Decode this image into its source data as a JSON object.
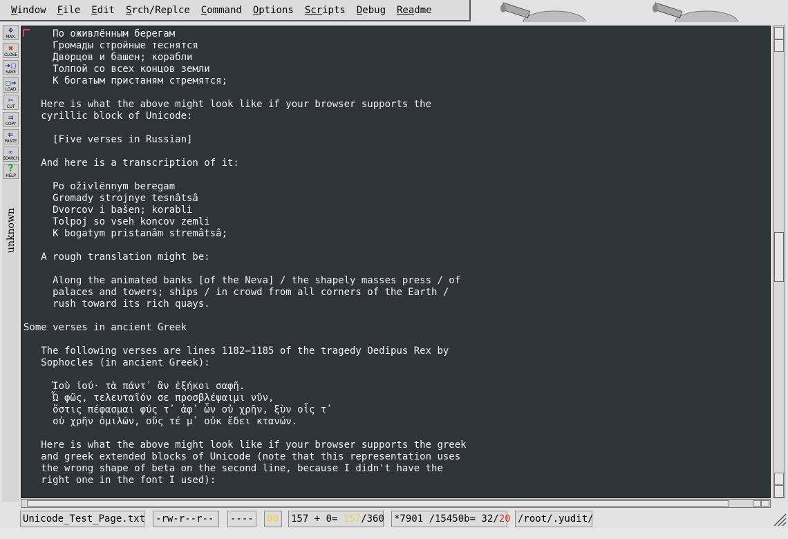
{
  "menubar": {
    "items": [
      {
        "name": "menu-window",
        "first": "W",
        "rest": "indow"
      },
      {
        "name": "menu-file",
        "first": "F",
        "rest": "ile"
      },
      {
        "name": "menu-edit",
        "first": "E",
        "rest": "dit"
      },
      {
        "name": "menu-search-replace",
        "first": "S",
        "rest": "rch/Replce"
      },
      {
        "name": "menu-command",
        "first": "C",
        "rest": "ommand"
      },
      {
        "name": "menu-options",
        "first": "O",
        "rest": "ptions"
      },
      {
        "name": "menu-scripts",
        "first": "Scr",
        "rest": "ipts"
      },
      {
        "name": "menu-debug",
        "first": "D",
        "rest": "ebug"
      },
      {
        "name": "menu-readme",
        "first": "Rea",
        "rest": "dme"
      }
    ]
  },
  "toolbar": {
    "tools": [
      {
        "name": "maximize-tool",
        "icon": "maximize-icon",
        "glyph": "✥",
        "label": "MAX."
      },
      {
        "name": "close-tool",
        "icon": "close-icon",
        "glyph": "✖",
        "label": "CLOSE"
      },
      {
        "name": "save-tool",
        "icon": "save-icon",
        "glyph": "➔▢",
        "label": "SAVE"
      },
      {
        "name": "load-tool",
        "icon": "load-icon",
        "glyph": "▢➔",
        "label": "LOAD"
      },
      {
        "name": "cut-tool",
        "icon": "cut-icon",
        "glyph": "✂",
        "label": "CUT"
      },
      {
        "name": "copy-tool",
        "icon": "copy-icon",
        "glyph": "⇉",
        "label": "COPY"
      },
      {
        "name": "paste-tool",
        "icon": "paste-icon",
        "glyph": "⇇",
        "label": "PASTE"
      },
      {
        "name": "search-tool",
        "icon": "binoculars-icon",
        "glyph": "∞",
        "label": "SEARCH"
      },
      {
        "name": "help-tool",
        "icon": "help-icon",
        "glyph": "?",
        "label": "HELP"
      }
    ],
    "vertical_label": "unknown"
  },
  "editor": {
    "lines": [
      "     По оживлённым берегам",
      "     Громады стройные теснятся",
      "     Дворцов и башен; корабли",
      "     Толпой со всех концов земли",
      "     К богатым пристаням стремятся;",
      "",
      "   Here is what the above might look like if your browser supports the",
      "   cyrillic block of Unicode:",
      "",
      "     [Five verses in Russian]",
      "",
      "   And here is a transcription of it:",
      "",
      "     Po oživlënnym beregam",
      "     Gromady strojnye tesnâtsâ",
      "     Dvorcov i bašen; korabli",
      "     Tolpoj so vseh koncov zemli",
      "     K bogatym pristanâm stremâtsâ;",
      "",
      "   A rough translation might be:",
      "",
      "     Along the animated banks [of the Neva] / the shapely masses press / of",
      "     palaces and towers; ships / in crowd from all corners of the Earth /",
      "     rush toward its rich quays.",
      "",
      "Some verses in ancient Greek",
      "",
      "   The following verses are lines 1182–1185 of the tragedy Oedipus Rex by",
      "   Sophocles (in ancient Greek):",
      "",
      "     Ἰοὺ ἰού· τὰ πάντ᾽ ἂν ἐξήκοι σαφῆ.",
      "     Ὦ φῶς, τελευταῖόν σε προσβλέψαιμι νῦν,",
      "     ὅστις πέφασμαι φύς τ᾽ ἀφ᾽ ὧν οὐ χρῆν, ξὺν οἷς τ᾽",
      "     οὐ χρῆν ὁμιλῶν, οὕς τέ μ᾽ οὐκ ἔδει κτανών.",
      "",
      "   Here is what the above might look like if your browser supports the greek",
      "   and greek extended blocks of Unicode (note that this representation uses",
      "   the wrong shape of beta on the second line, because I didn't have the",
      "   right one in the font I used):"
    ]
  },
  "status": {
    "filename": "Unicode_Test_Page.txt",
    "permissions": "-rw-r--r--",
    "flags": "----",
    "mode": "00",
    "line_prefix": "157 + 0= ",
    "line_current": "157",
    "line_total": "/360",
    "char_prefix": "*7901 /15450b= 32/",
    "char_col": "20",
    "path": "/root/.yudit/"
  },
  "colors": {
    "editor_bg": "#2d3537",
    "text": "#f2f2f2",
    "cursor": "#e23b6e",
    "status_yellow": "#e8d84a",
    "status_red": "#c0392b"
  }
}
